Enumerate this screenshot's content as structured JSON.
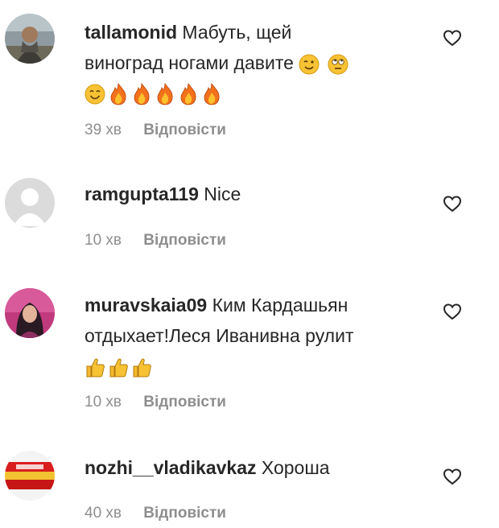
{
  "comments": [
    {
      "username": "tallamonid",
      "text_line1": "Мабуть, щей",
      "text_line2": "виноград ногами давите",
      "time": "39 хв",
      "reply_label": "Відповісти",
      "avatar": "photo-man-outdoors",
      "emojis_inline": [
        "wink-face",
        "eye-roll-face"
      ],
      "emojis_line3": [
        "smiling-face",
        "fire",
        "fire",
        "fire",
        "fire",
        "fire"
      ]
    },
    {
      "username": "ramgupta119",
      "text_line1": "Nice",
      "time": "10 хв",
      "reply_label": "Відповісти",
      "avatar": "default-user-silhouette"
    },
    {
      "username": "muravskaia09",
      "text_line1": "Ким Кардашьян",
      "text_line2": "отдыхает!Леся Иванивна рулит",
      "time": "10 хв",
      "reply_label": "Відповісти",
      "avatar": "photo-woman-purple",
      "emojis_line3": [
        "thumbs-up",
        "thumbs-up",
        "thumbs-up"
      ]
    },
    {
      "username": "nozhi__vladikavkaz",
      "text_line1": "Хороша",
      "time": "40 хв",
      "reply_label": "Відповісти",
      "avatar": "logo-red-yellow-flag"
    }
  ],
  "icons": {
    "like": "heart-outline-icon"
  },
  "colors": {
    "text": "#262626",
    "meta": "#8e8e8e",
    "background": "#ffffff"
  }
}
